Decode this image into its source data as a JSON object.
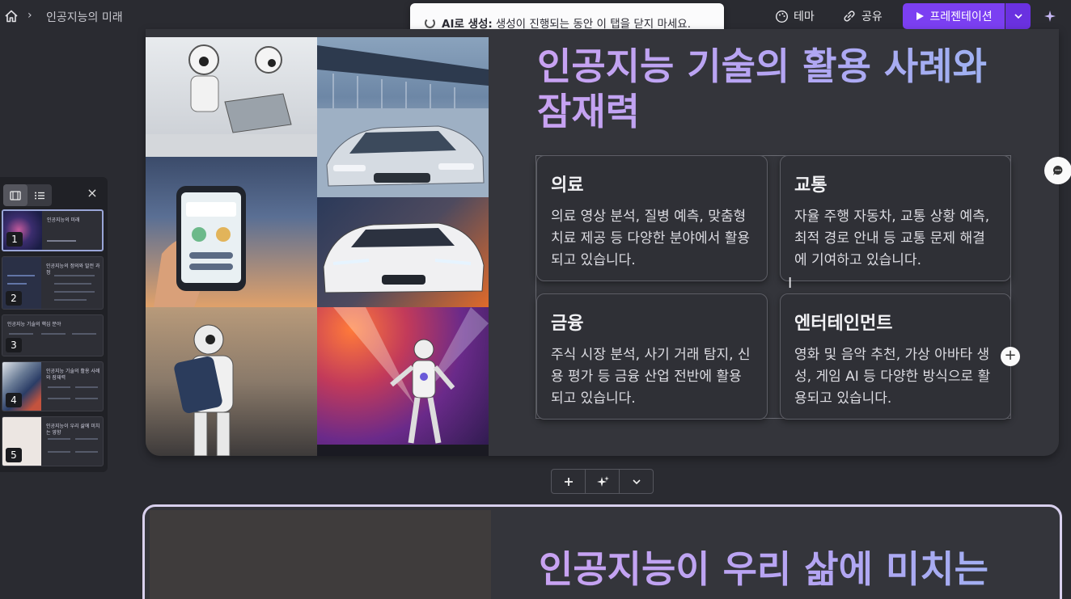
{
  "header": {
    "breadcrumb_separator": "›",
    "doc_title": "인공지능의 미래",
    "toast_bold": "AI로 생성:",
    "toast_text": "생성이 진행되는 동안 이 탭을 닫지 마세요.",
    "theme_label": "테마",
    "share_label": "공유",
    "present_label": "프레젠테이션"
  },
  "colors": {
    "accent": "#7b3ff2",
    "title_gradient_start": "#c9a2f2",
    "title_gradient_end": "#9bb3f2"
  },
  "sidebar": {
    "close_label": "×",
    "thumbs": [
      {
        "num": "1",
        "title": "인공지능의 미래"
      },
      {
        "num": "2",
        "title": "인공지능의 정의와 발전 과정"
      },
      {
        "num": "3",
        "title": "인공지능 기술의 핵심 분야"
      },
      {
        "num": "4",
        "title": "인공지능 기술의 활용 사례와 잠재력"
      },
      {
        "num": "5",
        "title": "인공지능이 우리 삶에 미치는 영향"
      }
    ]
  },
  "slide": {
    "title": "인공지능 기술의 활용 사례와 잠재력",
    "cards": [
      {
        "heading": "의료",
        "body": "의료 영상 분석, 질병 예측, 맞춤형 치료 제공 등 다양한 분야에서 활용되고 있습니다."
      },
      {
        "heading": "교통",
        "body": "자율 주행 자동차, 교통 상황 예측, 최적 경로 안내 등 교통 문제 해결에 기여하고 있습니다."
      },
      {
        "heading": "금융",
        "body": "주식 시장 분석, 사기 거래 탐지, 신용 평가 등 금융 산업 전반에 활용되고 있습니다."
      },
      {
        "heading": "엔터테인먼트",
        "body": "영화 및 음악 추천, 가상 아바타 생성, 게임 AI 등 다양한 방식으로 활용되고 있습니다."
      }
    ]
  },
  "next_slide": {
    "title": "인공지능이 우리 삶에 미치는"
  }
}
